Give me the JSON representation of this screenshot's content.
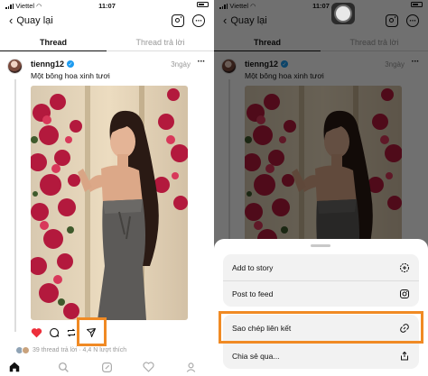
{
  "status_bar": {
    "carrier": "Viettel",
    "time": "11:07"
  },
  "header": {
    "back_label": "Quay lại"
  },
  "tabs": [
    {
      "label": "Thread",
      "active": true
    },
    {
      "label": "Thread trả lời",
      "active": false
    }
  ],
  "post": {
    "username": "tienng12",
    "verified": true,
    "time": "3ngày",
    "caption": "Một bông hoa xinh tươi",
    "stats": "39 thread trả lời · 4,4 N lượt thích",
    "liked": true
  },
  "share_sheet": {
    "group_1": [
      {
        "label": "Add to story",
        "icon": "add-story-icon"
      },
      {
        "label": "Post to feed",
        "icon": "instagram-icon"
      }
    ],
    "group_2": [
      {
        "label": "Sao chép liên kết",
        "icon": "link-icon"
      },
      {
        "label": "Chia sẻ qua...",
        "icon": "share-icon"
      }
    ]
  },
  "colors": {
    "highlight": "#f08a24",
    "like": "#ed2f3b",
    "verified": "#1d9bf0"
  },
  "bottom_nav": [
    "home-icon",
    "search-icon",
    "compose-icon",
    "heart-icon",
    "profile-icon"
  ]
}
